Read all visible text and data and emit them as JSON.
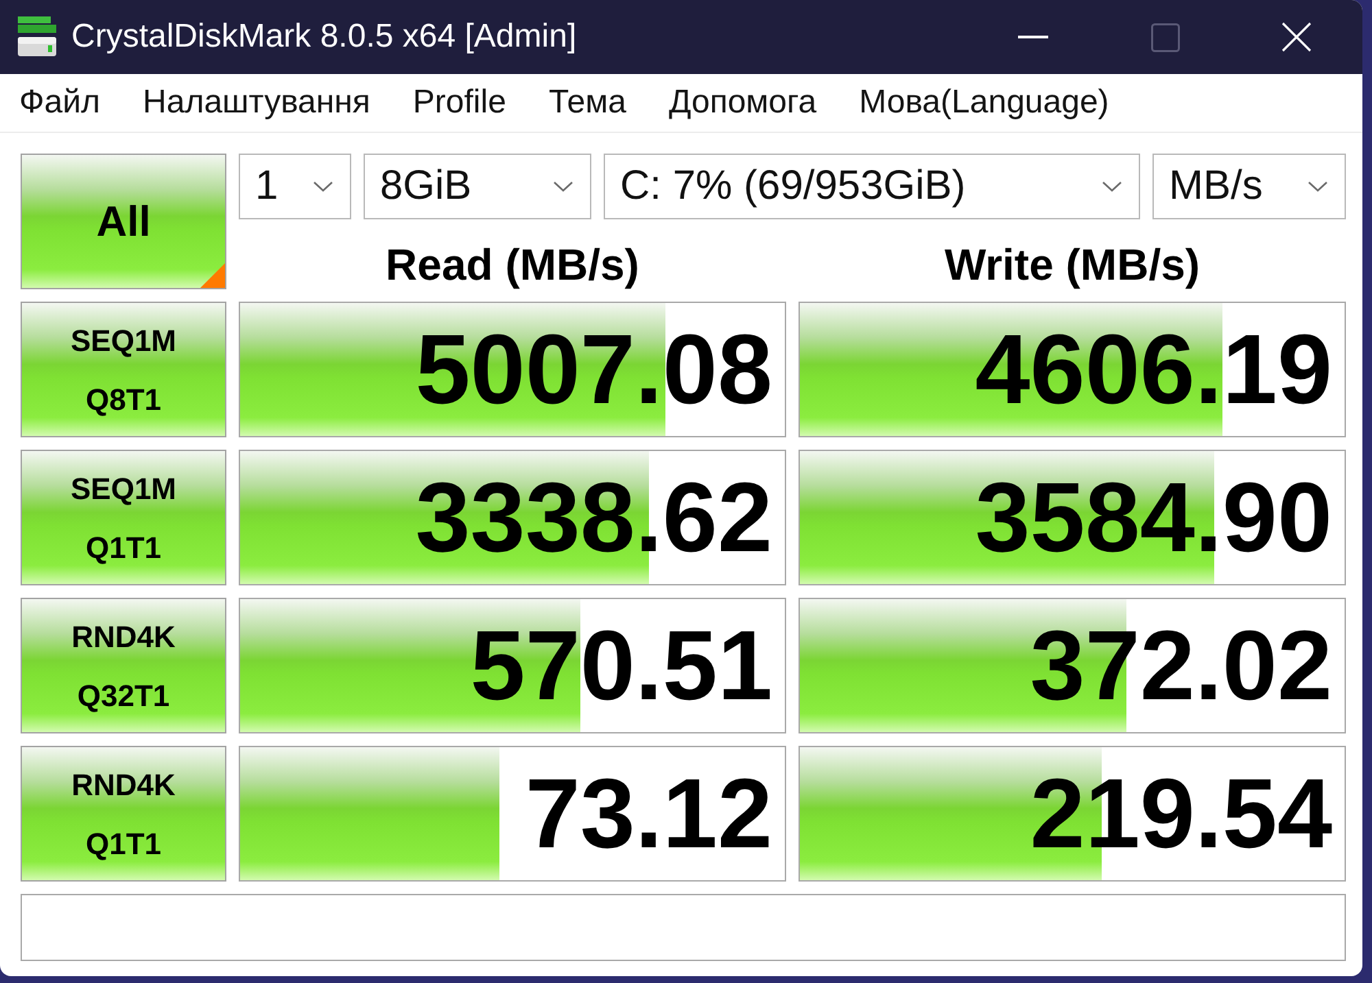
{
  "window": {
    "title": "CrystalDiskMark 8.0.5 x64 [Admin]",
    "maximize_disabled": true
  },
  "menu": [
    "Файл",
    "Налаштування",
    "Profile",
    "Тема",
    "Допомога",
    "Мова(Language)"
  ],
  "toolbar": {
    "all_button": "All",
    "count": "1",
    "size": "8GiB",
    "drive": "C: 7% (69/953GiB)",
    "unit": "MB/s"
  },
  "columns": [
    "Read (MB/s)",
    "Write (MB/s)"
  ],
  "tests": [
    {
      "name": "SEQ1M",
      "params": "Q8T1",
      "read": {
        "value": "5007.08",
        "level": 0.78
      },
      "write": {
        "value": "4606.19",
        "level": 0.776
      }
    },
    {
      "name": "SEQ1M",
      "params": "Q1T1",
      "read": {
        "value": "3338.62",
        "level": 0.75
      },
      "write": {
        "value": "3584.90",
        "level": 0.76
      }
    },
    {
      "name": "RND4K",
      "params": "Q32T1",
      "read": {
        "value": "570.51",
        "level": 0.625
      },
      "write": {
        "value": "372.02",
        "level": 0.6
      }
    },
    {
      "name": "RND4K",
      "params": "Q1T1",
      "read": {
        "value": "73.12",
        "level": 0.477
      },
      "write": {
        "value": "219.54",
        "level": 0.553
      }
    }
  ]
}
